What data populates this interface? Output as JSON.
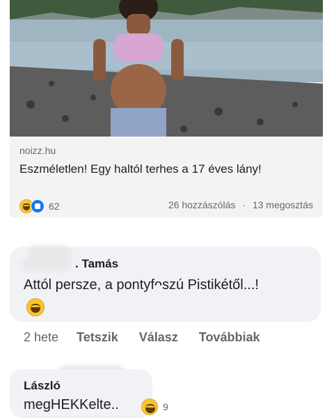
{
  "post": {
    "source": "noizz.hu",
    "headline": "Eszméletlen! Egy haltól terhes a 17 éves lány!",
    "reaction_count": "62",
    "comments_count": "26 hozzászólás",
    "separator": "·",
    "shares_count": "13 megosztás"
  },
  "comments": [
    {
      "author": ". Tamás",
      "text": "Attól persze, a pontyfᴖszú Pistikétől...!",
      "reaction": "haha-icon"
    },
    {
      "author": "László",
      "text": "megHEKKelte..",
      "reaction_count": "9"
    }
  ],
  "comment_actions": {
    "time": "2 hete",
    "like": "Tetszik",
    "reply": "Válasz",
    "more": "Továbbiak"
  },
  "colors": {
    "card_bg": "#f3f3f3",
    "bubble_bg": "#f0f2f5",
    "secondary_text": "#65676b",
    "like_blue": "#1877f2",
    "haha_yellow": "#f7c531"
  }
}
